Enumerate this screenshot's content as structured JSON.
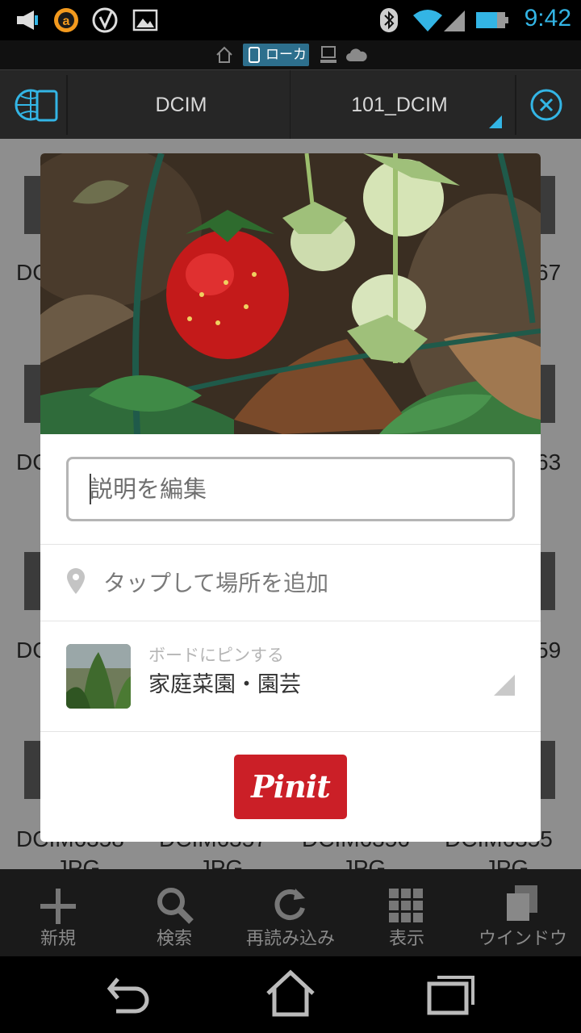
{
  "status_bar": {
    "time": "9:42",
    "notification_icons": [
      "megaphone-icon",
      "a-circle-icon",
      "c-logo-icon",
      "image-icon"
    ],
    "system_icons": [
      "bluetooth-icon",
      "wifi-icon",
      "signal-icon",
      "battery-icon"
    ]
  },
  "source_bar": {
    "items": [
      "home-icon",
      "local",
      "pc-icon",
      "cloud-icon"
    ],
    "local_label": "ローカル"
  },
  "path_bar": {
    "segments": [
      "DCIM",
      "101_DCIM"
    ]
  },
  "file_grid": {
    "visible_fragments": [
      "DC",
      "DC",
      "DC",
      "DCIM6358",
      "DCIM6357",
      "DCIM6356",
      "DCIM6355",
      "67",
      "63",
      "59",
      ".JPG",
      ".JPG",
      ".JPG",
      ".JPG"
    ]
  },
  "dialog": {
    "description_placeholder": "説明を編集",
    "place_label": "タップして場所を追加",
    "board_caption": "ボードにピンする",
    "board_name": "家庭菜園・園芸",
    "pin_button_label": "Pinit"
  },
  "toolbar": {
    "items": [
      {
        "label": "新規",
        "icon": "plus-icon"
      },
      {
        "label": "検索",
        "icon": "search-icon"
      },
      {
        "label": "再読み込み",
        "icon": "refresh-icon"
      },
      {
        "label": "表示",
        "icon": "grid-icon"
      },
      {
        "label": "ウインドウ",
        "icon": "window-icon"
      }
    ]
  },
  "nav_bar": {
    "items": [
      "back-icon",
      "home-icon",
      "recents-icon"
    ]
  },
  "colors": {
    "accent_blue": "#33b5e5",
    "pinterest_red": "#cb1f27"
  }
}
